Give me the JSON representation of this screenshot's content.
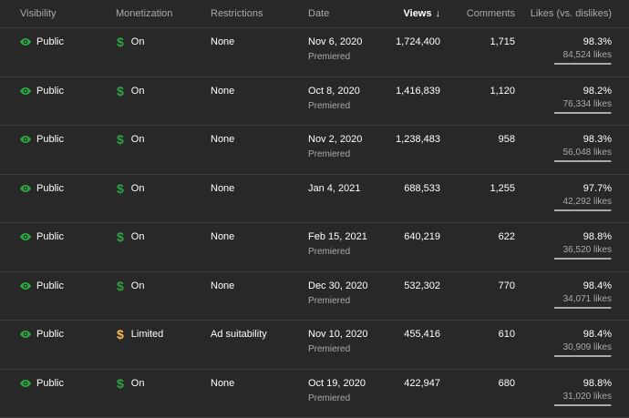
{
  "header": {
    "visibility": "Visibility",
    "monetization": "Monetization",
    "restrictions": "Restrictions",
    "date": "Date",
    "views": "Views",
    "views_sort_icon": "arrow-down-icon",
    "comments": "Comments",
    "likes": "Likes (vs. dislikes)"
  },
  "colors": {
    "background": "#282828",
    "public_green": "#2ba640",
    "monetization_on": "#2ba640",
    "monetization_limited": "#f9ba4b"
  },
  "rows": [
    {
      "visibility": "Public",
      "monetization": "On",
      "monetization_status": "on",
      "restrictions": "None",
      "date": "Nov 6, 2020",
      "date_sub": "Premiered",
      "views": "1,724,400",
      "comments": "1,715",
      "likes_pct": "98.3%",
      "likes_count": "84,524 likes",
      "like_ratio": 0.983
    },
    {
      "visibility": "Public",
      "monetization": "On",
      "monetization_status": "on",
      "restrictions": "None",
      "date": "Oct 8, 2020",
      "date_sub": "Premiered",
      "views": "1,416,839",
      "comments": "1,120",
      "likes_pct": "98.2%",
      "likes_count": "76,334 likes",
      "like_ratio": 0.982
    },
    {
      "visibility": "Public",
      "monetization": "On",
      "monetization_status": "on",
      "restrictions": "None",
      "date": "Nov 2, 2020",
      "date_sub": "Premiered",
      "views": "1,238,483",
      "comments": "958",
      "likes_pct": "98.3%",
      "likes_count": "56,048 likes",
      "like_ratio": 0.983
    },
    {
      "visibility": "Public",
      "monetization": "On",
      "monetization_status": "on",
      "restrictions": "None",
      "date": "Jan 4, 2021",
      "date_sub": "",
      "views": "688,533",
      "comments": "1,255",
      "likes_pct": "97.7%",
      "likes_count": "42,292 likes",
      "like_ratio": 0.977
    },
    {
      "visibility": "Public",
      "monetization": "On",
      "monetization_status": "on",
      "restrictions": "None",
      "date": "Feb 15, 2021",
      "date_sub": "Premiered",
      "views": "640,219",
      "comments": "622",
      "likes_pct": "98.8%",
      "likes_count": "36,520 likes",
      "like_ratio": 0.988
    },
    {
      "visibility": "Public",
      "monetization": "On",
      "monetization_status": "on",
      "restrictions": "None",
      "date": "Dec 30, 2020",
      "date_sub": "Premiered",
      "views": "532,302",
      "comments": "770",
      "likes_pct": "98.4%",
      "likes_count": "34,071 likes",
      "like_ratio": 0.984
    },
    {
      "visibility": "Public",
      "monetization": "Limited",
      "monetization_status": "limited",
      "restrictions": "Ad suitability",
      "date": "Nov 10, 2020",
      "date_sub": "Premiered",
      "views": "455,416",
      "comments": "610",
      "likes_pct": "98.4%",
      "likes_count": "30,909 likes",
      "like_ratio": 0.984
    },
    {
      "visibility": "Public",
      "monetization": "On",
      "monetization_status": "on",
      "restrictions": "None",
      "date": "Oct 19, 2020",
      "date_sub": "Premiered",
      "views": "422,947",
      "comments": "680",
      "likes_pct": "98.8%",
      "likes_count": "31,020 likes",
      "like_ratio": 0.988
    }
  ]
}
